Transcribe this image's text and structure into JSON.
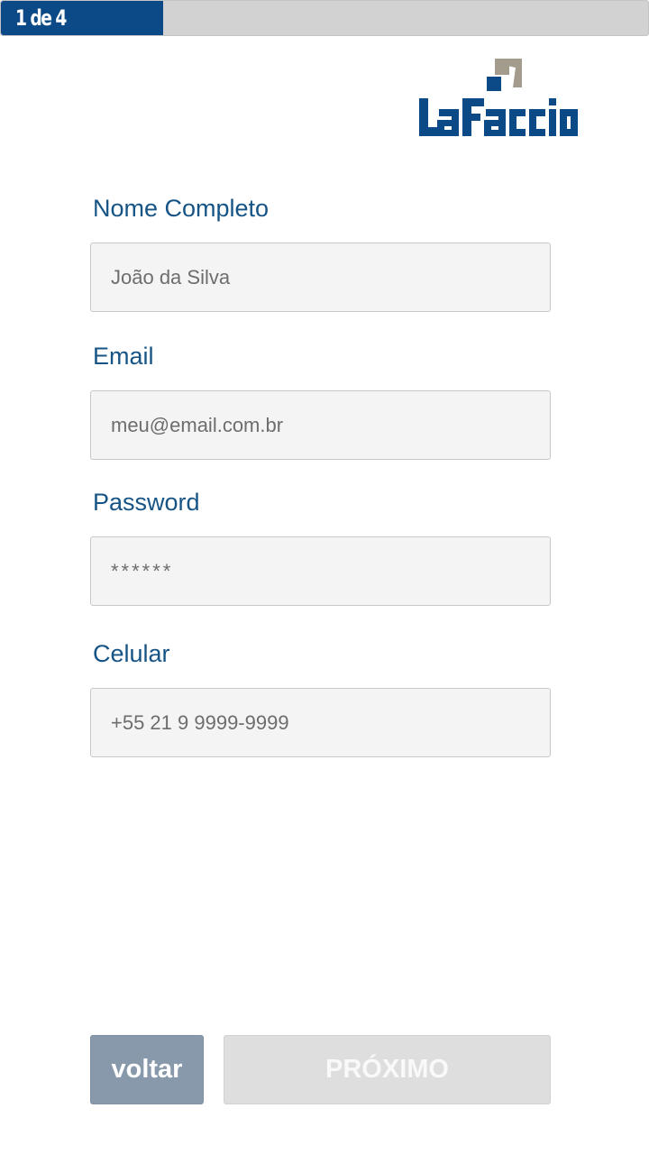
{
  "progress": {
    "label": "1 de 4",
    "current_step": 1,
    "total_steps": 4,
    "fraction": 0.25,
    "color": "#0b4a86"
  },
  "logo": {
    "text": "LaFaccio",
    "brand_color": "#0b4a86",
    "accent_color": "#a39b8b"
  },
  "form": {
    "fields": [
      {
        "label": "Nome Completo",
        "placeholder": "João da Silva",
        "type": "text"
      },
      {
        "label": "Email",
        "placeholder": "meu@email.com.br",
        "type": "email"
      },
      {
        "label": "Password",
        "placeholder": "******",
        "type": "password"
      },
      {
        "label": "Celular",
        "placeholder": "+55 21 9 9999-9999",
        "type": "tel"
      }
    ]
  },
  "buttons": {
    "back_label": "voltar",
    "next_label": "PRÓXIMO"
  }
}
